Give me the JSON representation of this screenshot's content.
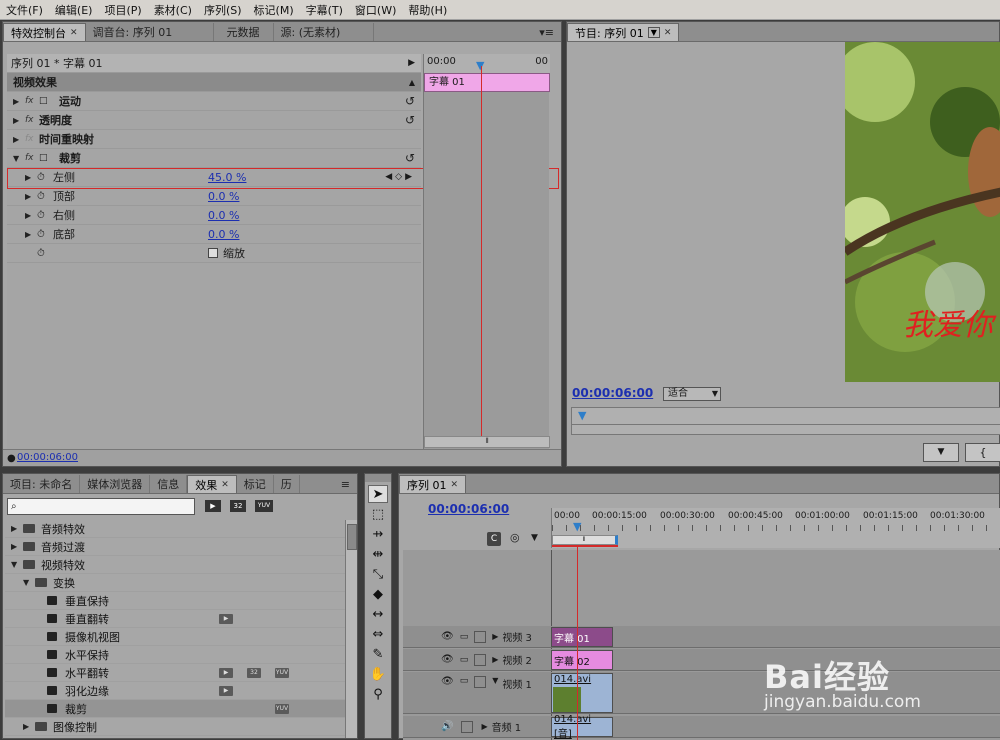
{
  "menu": [
    "文件(F)",
    "编辑(E)",
    "项目(P)",
    "素材(C)",
    "序列(S)",
    "标记(M)",
    "字幕(T)",
    "窗口(W)",
    "帮助(H)"
  ],
  "effect_controls": {
    "tabs": [
      "特效控制台",
      "调音台: 序列 01",
      "元数据",
      "源: (无素材)"
    ],
    "sequence_label": "序列 01 * 字幕 01",
    "section_header": "视频效果",
    "effects": [
      "运动",
      "透明度",
      "时间重映射",
      "裁剪"
    ],
    "crop_params": [
      {
        "name": "左侧",
        "value": "45.0 %"
      },
      {
        "name": "顶部",
        "value": "0.0 %"
      },
      {
        "name": "右侧",
        "value": "0.0 %"
      },
      {
        "name": "底部",
        "value": "0.0 %"
      }
    ],
    "scale_label": "缩放",
    "timeline_start": "00:00",
    "timeline_end": "00",
    "clip_label": "字幕 01",
    "timecode": "00:00:06:00"
  },
  "program_monitor": {
    "tab": "节目: 序列 01",
    "timecode": "00:00:06:00",
    "fit_label": "适合",
    "overlay_text": "我爱你"
  },
  "project_panel": {
    "tabs": [
      "项目: 未命名",
      "媒体浏览器",
      "信息",
      "效果",
      "标记",
      "历"
    ],
    "badges": [
      "32",
      "YUV"
    ],
    "tree": [
      {
        "label": "音频特效",
        "level": 0,
        "type": "folder"
      },
      {
        "label": "音频过渡",
        "level": 0,
        "type": "folder"
      },
      {
        "label": "视频特效",
        "level": 0,
        "type": "folder"
      },
      {
        "label": "变换",
        "level": 1,
        "type": "folder"
      },
      {
        "label": "垂直保持",
        "level": 2,
        "type": "fx"
      },
      {
        "label": "垂直翻转",
        "level": 2,
        "type": "fx"
      },
      {
        "label": "摄像机视图",
        "level": 2,
        "type": "fx"
      },
      {
        "label": "水平保持",
        "level": 2,
        "type": "fx"
      },
      {
        "label": "水平翻转",
        "level": 2,
        "type": "fx"
      },
      {
        "label": "羽化边缘",
        "level": 2,
        "type": "fx"
      },
      {
        "label": "裁剪",
        "level": 2,
        "type": "fx"
      },
      {
        "label": "图像控制",
        "level": 1,
        "type": "folder"
      }
    ]
  },
  "sequence": {
    "tab": "序列 01",
    "timecode": "00:00:06:00",
    "ruler": [
      "00:00",
      "00:00:15:00",
      "00:00:30:00",
      "00:00:45:00",
      "00:01:00:00",
      "00:01:15:00",
      "00:01:30:00"
    ],
    "tracks": [
      {
        "name": "视频 3",
        "clip": "字幕 01"
      },
      {
        "name": "视频 2",
        "clip": "字幕 02"
      },
      {
        "name": "视频 1",
        "clip": "014.avi [视]"
      },
      {
        "name": "音频 1",
        "clip": "014.avi [音]"
      }
    ]
  },
  "watermark": {
    "brand": "Bai经验",
    "url": "jingyan.baidu.com"
  }
}
